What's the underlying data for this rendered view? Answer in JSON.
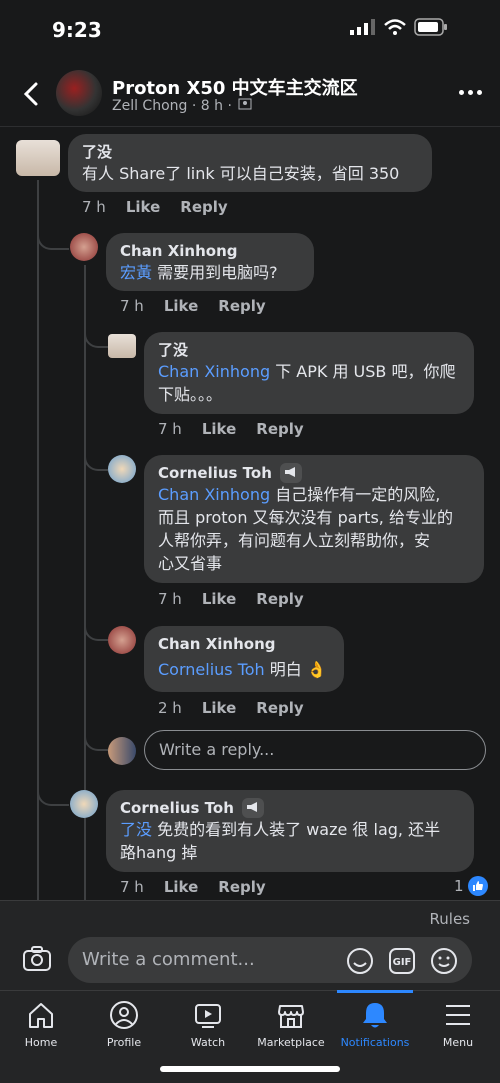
{
  "status": {
    "time": "9:23"
  },
  "header": {
    "title": "Proton X50 中文车主交流区",
    "subtitle": "Zell Chong · 8 h ·"
  },
  "comments": [
    {
      "author": "了没",
      "mention": "",
      "text": "有人 Share了 link 可以自己安装，省回 350",
      "time": "7 h",
      "like": "Like",
      "reply": "Reply"
    },
    {
      "author": "Chan Xinhong",
      "mention": "宏黃",
      "text": " 需要用到电脑吗?",
      "time": "7 h",
      "like": "Like",
      "reply": "Reply"
    },
    {
      "author": "了没",
      "mention": "Chan Xinhong",
      "text": " 下 APK 用 USB 吧，你爬",
      "text2": "下贴。。。",
      "time": "7 h",
      "like": "Like",
      "reply": "Reply"
    },
    {
      "author": "Cornelius Toh",
      "mention": "Chan Xinhong",
      "text": " 自己操作有一定的风险,",
      "text2": "而且 proton 又每次没有 parts, 给专业的",
      "text3": "人帮你弄，有问题有人立刻帮助你，安",
      "text4": "心又省事",
      "time": "7 h",
      "like": "Like",
      "reply": "Reply"
    },
    {
      "author": "Chan Xinhong",
      "mention": "Cornelius Toh",
      "text": " 明白",
      "time": "2 h",
      "like": "Like",
      "reply": "Reply"
    },
    {
      "author": "Cornelius Toh",
      "mention": "了没",
      "text": " 免费的看到有人装了 waze 很 lag, 还半",
      "text2": "路hang 掉",
      "time": "7 h",
      "like": "Like",
      "reply": "Reply",
      "reaction_count": "1"
    }
  ],
  "reply_placeholder": "Write a reply...",
  "composer": {
    "rules": "Rules",
    "placeholder": "Write a comment..."
  },
  "tabs": [
    {
      "label": "Home",
      "icon": "home-icon"
    },
    {
      "label": "Profile",
      "icon": "profile-icon"
    },
    {
      "label": "Watch",
      "icon": "watch-icon"
    },
    {
      "label": "Marketplace",
      "icon": "marketplace-icon"
    },
    {
      "label": "Notifications",
      "icon": "bell-icon",
      "active": true
    },
    {
      "label": "Menu",
      "icon": "menu-icon"
    }
  ],
  "colors": {
    "background": "#18191a",
    "bubble": "#3a3b3c",
    "mention": "#5b9dff",
    "active_tab": "#2d88ff"
  }
}
